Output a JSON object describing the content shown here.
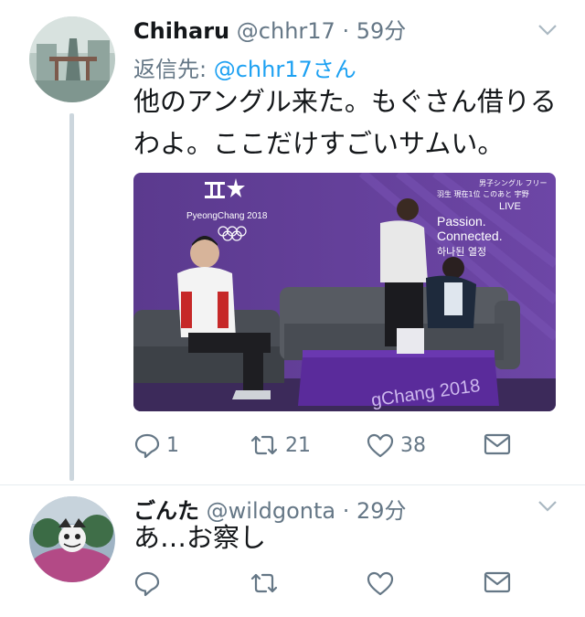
{
  "tweets": [
    {
      "name": "Chiharu",
      "handle": "@chhr17",
      "time": "· 59分",
      "reply_prefix": "返信先:",
      "reply_mention": "@chhr17さん",
      "text_line1": "他のアングル来た。もぐさん借りる",
      "text_line2": "わよ。ここだけすごいサムい。",
      "media": {
        "overlay_title": "男子シングル フリー",
        "overlay_sub": "羽生 現在1位 このあと 宇野",
        "live_label": "LIVE",
        "brand_logo": "PyeongChang 2018",
        "slogan_1": "Passion.",
        "slogan_2": "Connected.",
        "slogan_3": "하나된 열정",
        "table_text": "gChang 2018"
      },
      "replies": "1",
      "retweets": "21",
      "likes": "38"
    },
    {
      "name": "ごんた",
      "handle": "@wildgonta",
      "time": "· 29分",
      "text_line1": "あ…お察し"
    }
  ],
  "icons": [
    "reply-icon",
    "retweet-icon",
    "like-icon",
    "share-icon",
    "caret-down-icon"
  ],
  "colors": {
    "text": "#14171a",
    "secondary": "#657786",
    "link": "#1da1f2",
    "thread": "#ccd6dd"
  }
}
